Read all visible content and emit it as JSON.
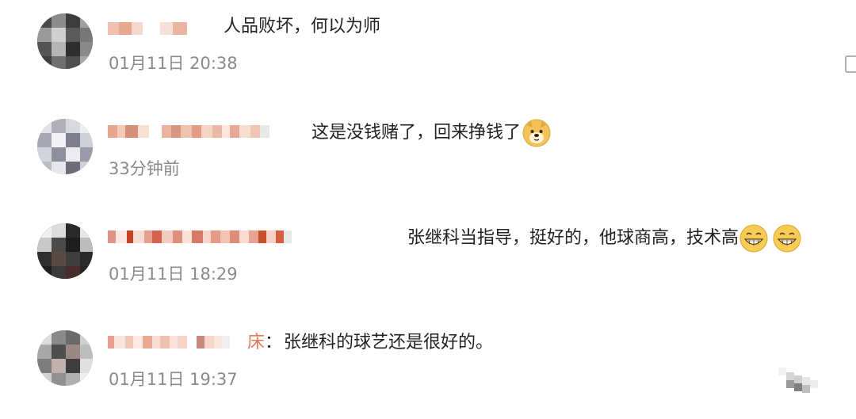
{
  "comments": [
    {
      "text": "人品败坏，何以为师",
      "time": "01月11日 20:38"
    },
    {
      "text": "这是没钱赌了，回来挣钱了",
      "time": "33分钟前",
      "emoji": [
        "doge-emoji"
      ]
    },
    {
      "text": "张继科当指导，挺好的，他球商高，技术高",
      "time": "01月11日 18:29",
      "emoji": [
        "grin-emoji",
        "grin-emoji"
      ]
    },
    {
      "nick_suffix": "床",
      "separator": "：",
      "text": "张继科的球艺还是很好的。",
      "time": "01月11日 19:37"
    }
  ],
  "colors": {
    "text": "#222222",
    "time": "#8a8a8a",
    "background": "#ffffff"
  }
}
